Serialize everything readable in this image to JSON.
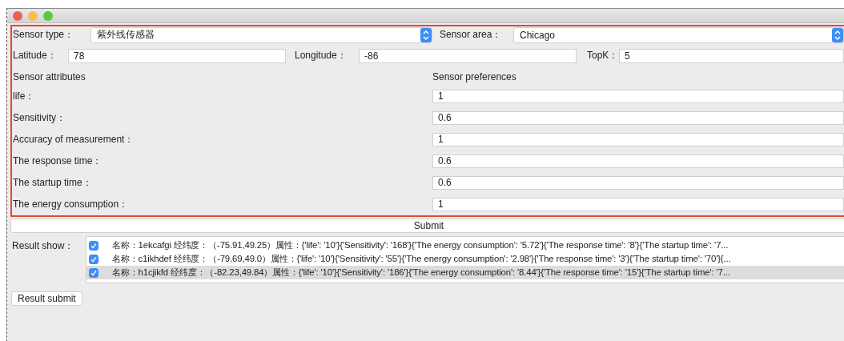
{
  "form": {
    "sensor_type": {
      "label": "Sensor type：",
      "value": "紫外线传感器"
    },
    "sensor_area": {
      "label": "Sensor area：",
      "value": "Chicago"
    },
    "latitude": {
      "label": "Latitude：",
      "value": "78"
    },
    "longitude": {
      "label": "Longitude：",
      "value": "-86"
    },
    "topk": {
      "label": "TopK：",
      "value": "5"
    },
    "attributes_heading": "Sensor attributes",
    "preferences_heading": "Sensor preferences",
    "attributes": [
      {
        "label": "life：",
        "value": "1"
      },
      {
        "label": "Sensitivity：",
        "value": "0.6"
      },
      {
        "label": "Accuracy of measurement：",
        "value": "1"
      },
      {
        "label": "The response time：",
        "value": "0.6"
      },
      {
        "label": "The startup time：",
        "value": "0.6"
      },
      {
        "label": "The energy consumption：",
        "value": "1"
      }
    ]
  },
  "submit_button": "Submit",
  "results": {
    "label": "Result show：",
    "rows": [
      {
        "text": "名称：1ekcafgi 经纬度：（-75.91,49.25）属性：{'life': '10'}{'Sensitivity': '168'}{'The energy consumption': '5.72'}{'The response time': '8'}{'The startup time': '7...",
        "checked": true,
        "selected": false
      },
      {
        "text": "名称：c1ikhdef 经纬度：（-79.69,49.0）属性：{'life': '10'}{'Sensitivity': '55'}{'The energy consumption': '2.98'}{'The response time': '3'}{'The startup time': '70'}{...",
        "checked": true,
        "selected": false
      },
      {
        "text": "名称：h1cjikfd 经纬度：（-82.23,49.84）属性：{'life': '10'}{'Sensitivity': '186'}{'The energy consumption': '8.44'}{'The response time': '15'}{'The startup time': '7...",
        "checked": true,
        "selected": true
      }
    ]
  },
  "result_submit_button": "Result submit"
}
